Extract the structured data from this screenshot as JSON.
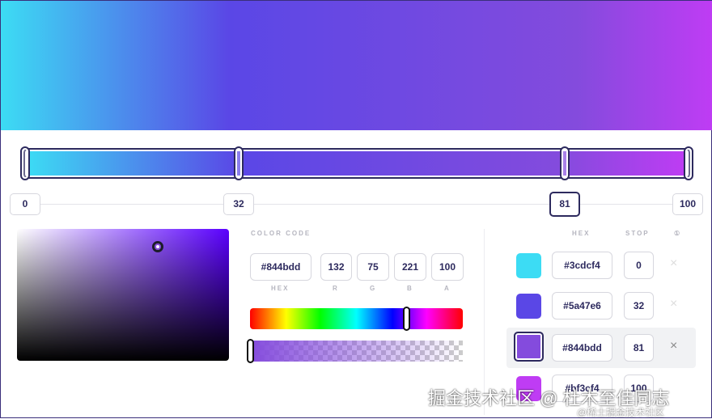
{
  "stops": [
    {
      "hex": "#3cdcf4",
      "stop": "0",
      "color": "#3cdcf4"
    },
    {
      "hex": "#5a47e6",
      "stop": "32",
      "color": "#5a47e6"
    },
    {
      "hex": "#844bdd",
      "stop": "81",
      "color": "#844bdd"
    },
    {
      "hex": "#bf3cf4",
      "stop": "100",
      "color": "#bf3cf4"
    }
  ],
  "editor": {
    "section_label": "COLOR CODE",
    "hex": "#844bdd",
    "r": "132",
    "g": "75",
    "b": "221",
    "a": "100",
    "labels": {
      "hex": "HEX",
      "r": "R",
      "g": "G",
      "b": "B",
      "a": "A"
    }
  },
  "list_headers": {
    "hex": "HEX",
    "stop": "STOP",
    "info": "①"
  },
  "remove_icon": "×",
  "watermark": {
    "main": "掘金技术社区 @ 杜木至佳同志",
    "sub": "@稀土掘金技术社区"
  }
}
